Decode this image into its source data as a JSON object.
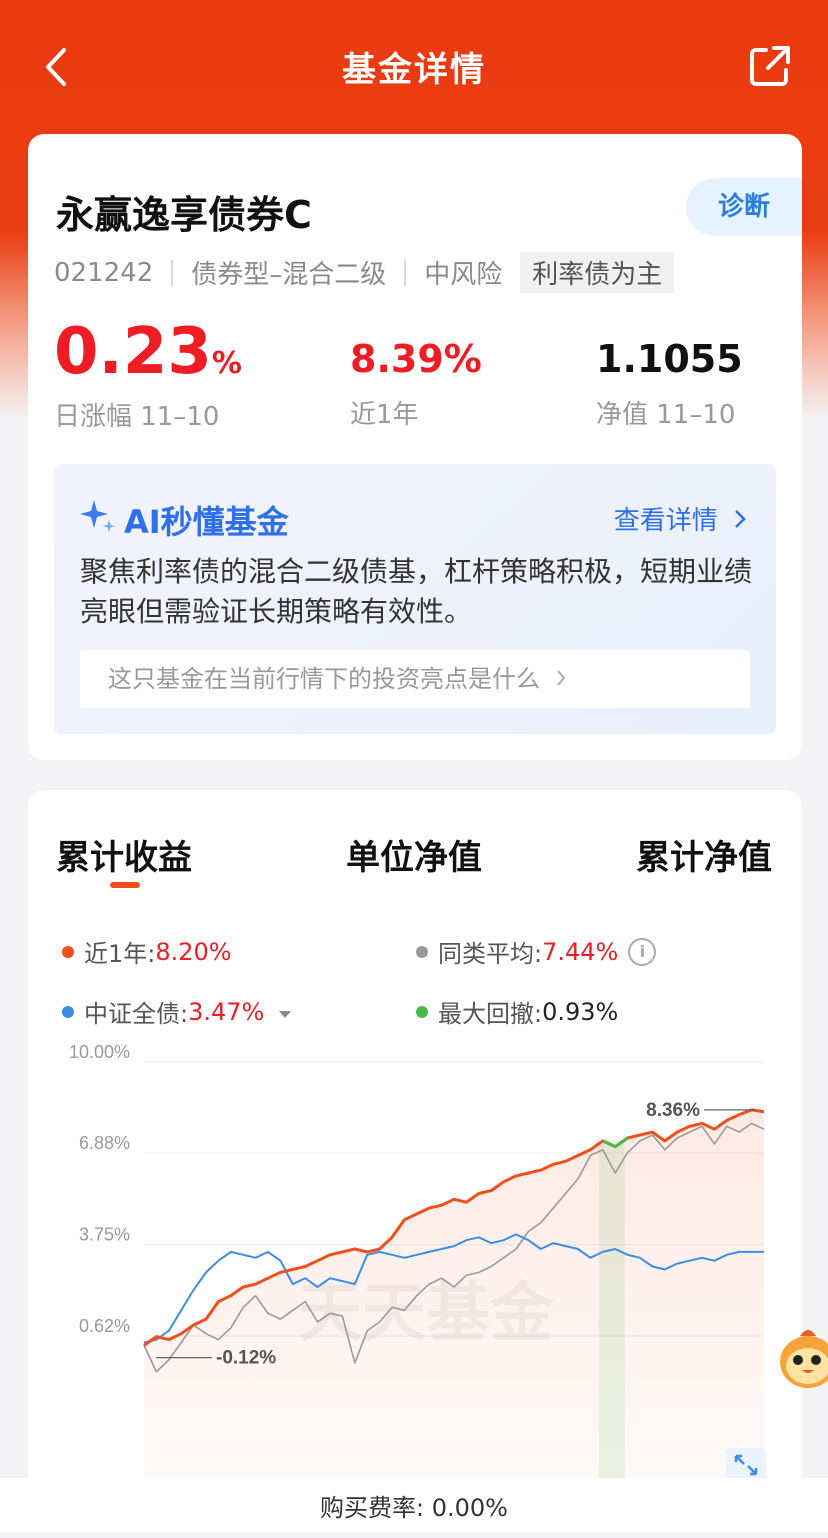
{
  "header": {
    "title": "基金详情"
  },
  "fund": {
    "name": "永赢逸享债券C",
    "diagnose_label": "诊断",
    "code": "021242",
    "type": "债券型–混合二级",
    "risk": "中风险",
    "tag": "利率债为主",
    "daily_change": "0.23",
    "daily_change_unit": "%",
    "daily_change_label": "日涨幅 11–10",
    "year_return": "8.39%",
    "year_return_label": "近1年",
    "nav": "1.1055",
    "nav_label": "净值 11–10"
  },
  "ai": {
    "title": "AI秒懂基金",
    "more": "查看详情",
    "summary": "聚焦利率债的混合二级债基，杠杆策略积极，短期业绩亮眼但需验证长期策略有效性。",
    "question": "这只基金在当前行情下的投资亮点是什么"
  },
  "tabs": [
    "累计收益",
    "单位净值",
    "累计净值"
  ],
  "legend": {
    "fund_label": "近1年:",
    "fund_value": "8.20%",
    "peer_label": "同类平均:",
    "peer_value": "7.44%",
    "index_label": "中证全债:",
    "index_value": "3.47%",
    "drawdown_label": "最大回撤:",
    "drawdown_value": "0.93%"
  },
  "colors": {
    "fund": "#f04e1b",
    "peer": "#9a9a9a",
    "index": "#3b8ee8",
    "drawdown": "#4cb84c",
    "up": "#ee1d23"
  },
  "chart_data": {
    "type": "line",
    "ylim": [
      -1.5,
      10
    ],
    "yticks": [
      "10.00%",
      "6.88%",
      "3.75%",
      "0.62%"
    ],
    "ytick_values": [
      10.0,
      6.88,
      3.75,
      0.62
    ],
    "annotations": {
      "max_label": "8.36%",
      "min_label": "-0.12%"
    },
    "watermark": "天天基金",
    "series": [
      {
        "name": "近1年",
        "values": [
          0.3,
          0.6,
          0.5,
          0.7,
          1.0,
          1.2,
          1.8,
          2.0,
          2.3,
          2.4,
          2.6,
          2.8,
          2.9,
          3.0,
          3.2,
          3.4,
          3.5,
          3.6,
          3.5,
          3.6,
          4.0,
          4.6,
          4.8,
          5.0,
          5.1,
          5.3,
          5.2,
          5.5,
          5.6,
          5.9,
          6.1,
          6.2,
          6.3,
          6.5,
          6.6,
          6.8,
          7.0,
          7.3,
          7.1,
          7.4,
          7.5,
          7.6,
          7.3,
          7.6,
          7.8,
          7.9,
          7.7,
          8.0,
          8.2,
          8.36,
          8.3
        ]
      },
      {
        "name": "同类平均",
        "values": [
          0.3,
          -0.6,
          -0.2,
          0.4,
          1.0,
          0.7,
          0.5,
          0.9,
          1.6,
          2.0,
          1.4,
          1.2,
          1.5,
          1.8,
          1.1,
          1.4,
          1.3,
          -0.3,
          0.8,
          1.1,
          1.6,
          1.5,
          2.0,
          2.4,
          2.6,
          2.3,
          2.7,
          2.8,
          3.0,
          3.3,
          3.6,
          4.2,
          4.5,
          5.0,
          5.5,
          6.0,
          6.8,
          7.0,
          6.2,
          6.9,
          7.3,
          7.5,
          7.0,
          7.4,
          7.6,
          7.8,
          7.2,
          7.8,
          7.6,
          7.9,
          7.7
        ]
      },
      {
        "name": "中证全债",
        "values": [
          0.4,
          0.5,
          0.8,
          1.5,
          2.2,
          2.8,
          3.2,
          3.5,
          3.4,
          3.3,
          3.5,
          3.2,
          2.4,
          2.6,
          2.3,
          2.6,
          2.5,
          2.4,
          3.4,
          3.5,
          3.4,
          3.3,
          3.4,
          3.5,
          3.6,
          3.7,
          3.9,
          4.0,
          3.8,
          3.9,
          4.1,
          3.9,
          3.6,
          3.8,
          3.7,
          3.6,
          3.3,
          3.5,
          3.6,
          3.4,
          3.3,
          3.0,
          2.9,
          3.1,
          3.2,
          3.3,
          3.2,
          3.4,
          3.5,
          3.5,
          3.5
        ]
      }
    ]
  },
  "footer": {
    "fee": "购买费率: 0.00%"
  }
}
